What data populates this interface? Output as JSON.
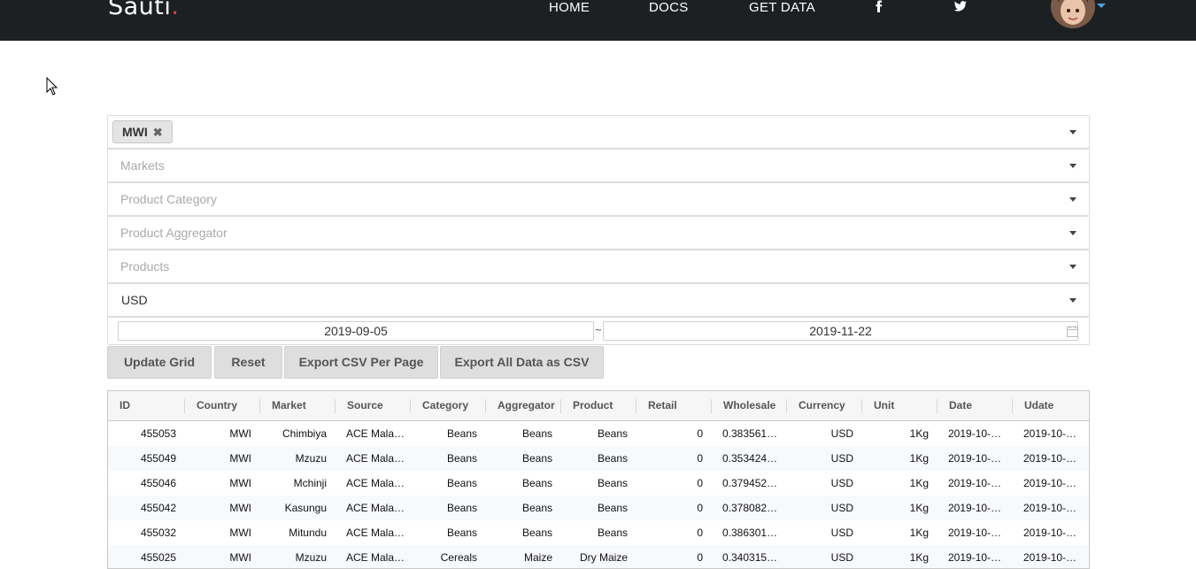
{
  "nav": {
    "brand": "Sauti",
    "brand_dot": ".",
    "links": [
      "HOME",
      "DOCS",
      "GET DATA"
    ],
    "social_icons": [
      "facebook-icon",
      "twitter-icon"
    ],
    "accent_color": "#e8413f"
  },
  "filters": {
    "country_chip": "MWI",
    "markets_placeholder": "Markets",
    "category_placeholder": "Product Category",
    "aggregator_placeholder": "Product Aggregator",
    "products_placeholder": "Products",
    "currency_value": "USD",
    "date_start": "2019-09-05",
    "date_sep": "~",
    "date_end": "2019-11-22"
  },
  "buttons": {
    "update": "Update Grid",
    "reset": "Reset",
    "export_page": "Export CSV Per Page",
    "export_all": "Export All Data as CSV"
  },
  "grid": {
    "columns": [
      "ID",
      "Country",
      "Market",
      "Source",
      "Category",
      "Aggregator",
      "Product",
      "Retail",
      "Wholesale",
      "Currency",
      "Unit",
      "Date",
      "Udate"
    ],
    "rows": [
      [
        "455053",
        "MWI",
        "Chimbiya",
        "ACE Mala…",
        "Beans",
        "Beans",
        "Beans",
        "0",
        "0.383561…",
        "USD",
        "1Kg",
        "2019-10-…",
        "2019-10-…"
      ],
      [
        "455049",
        "MWI",
        "Mzuzu",
        "ACE Mala…",
        "Beans",
        "Beans",
        "Beans",
        "0",
        "0.353424…",
        "USD",
        "1Kg",
        "2019-10-…",
        "2019-10-…"
      ],
      [
        "455046",
        "MWI",
        "Mchinji",
        "ACE Mala…",
        "Beans",
        "Beans",
        "Beans",
        "0",
        "0.379452…",
        "USD",
        "1Kg",
        "2019-10-…",
        "2019-10-…"
      ],
      [
        "455042",
        "MWI",
        "Kasungu",
        "ACE Mala…",
        "Beans",
        "Beans",
        "Beans",
        "0",
        "0.378082…",
        "USD",
        "1Kg",
        "2019-10-…",
        "2019-10-…"
      ],
      [
        "455032",
        "MWI",
        "Mitundu",
        "ACE Mala…",
        "Beans",
        "Beans",
        "Beans",
        "0",
        "0.386301…",
        "USD",
        "1Kg",
        "2019-10-…",
        "2019-10-…"
      ],
      [
        "455025",
        "MWI",
        "Mzuzu",
        "ACE Mala…",
        "Cereals",
        "Maize",
        "Dry Maize",
        "0",
        "0.340315…",
        "USD",
        "1Kg",
        "2019-10-…",
        "2019-10-…"
      ]
    ]
  }
}
